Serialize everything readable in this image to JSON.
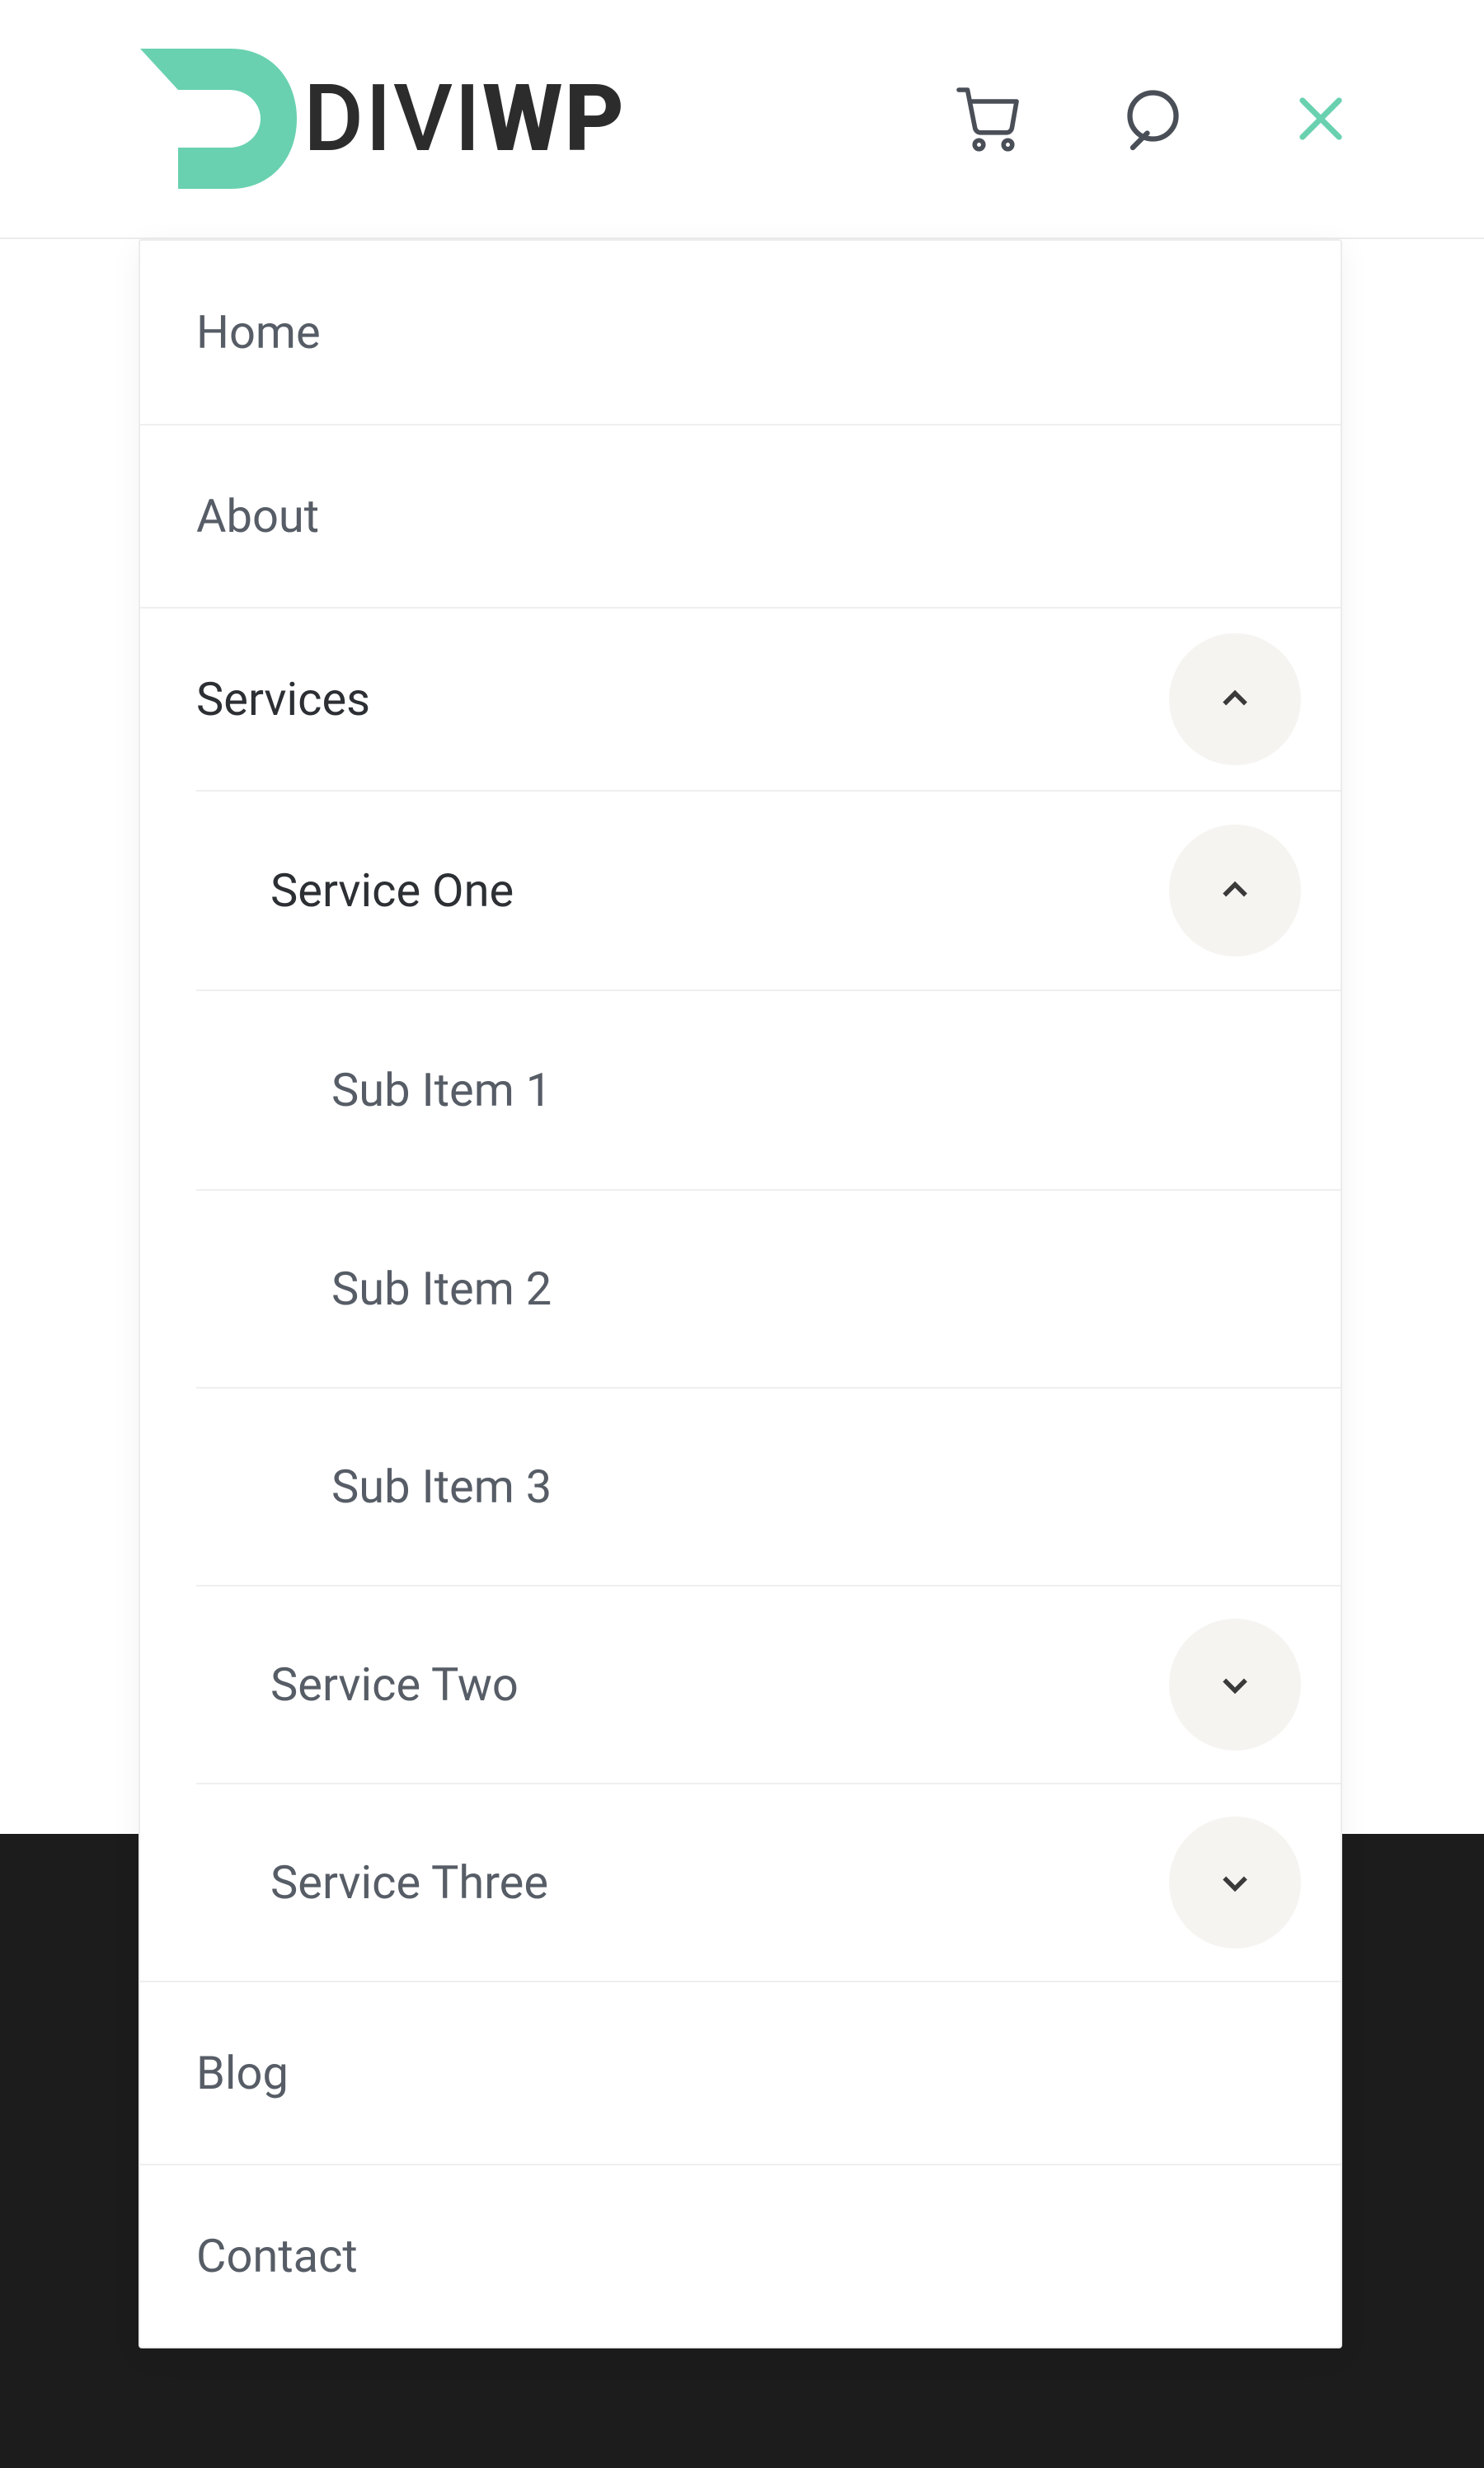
{
  "brand": {
    "divi": "DIVI",
    "wp": "WP",
    "accent": "#69d1b0"
  },
  "nav": {
    "items": [
      {
        "label": "Home",
        "expanded": false,
        "has_children": false
      },
      {
        "label": "About",
        "expanded": false,
        "has_children": false
      },
      {
        "label": "Services",
        "expanded": true,
        "has_children": true,
        "children": [
          {
            "label": "Service One",
            "expanded": true,
            "has_children": true,
            "children": [
              {
                "label": "Sub Item 1"
              },
              {
                "label": "Sub Item 2"
              },
              {
                "label": "Sub Item 3"
              }
            ]
          },
          {
            "label": "Service Two",
            "expanded": false,
            "has_children": true
          },
          {
            "label": "Service Three",
            "expanded": false,
            "has_children": true
          }
        ]
      },
      {
        "label": "Blog",
        "expanded": false,
        "has_children": false
      },
      {
        "label": "Contact",
        "expanded": false,
        "has_children": false
      }
    ]
  }
}
